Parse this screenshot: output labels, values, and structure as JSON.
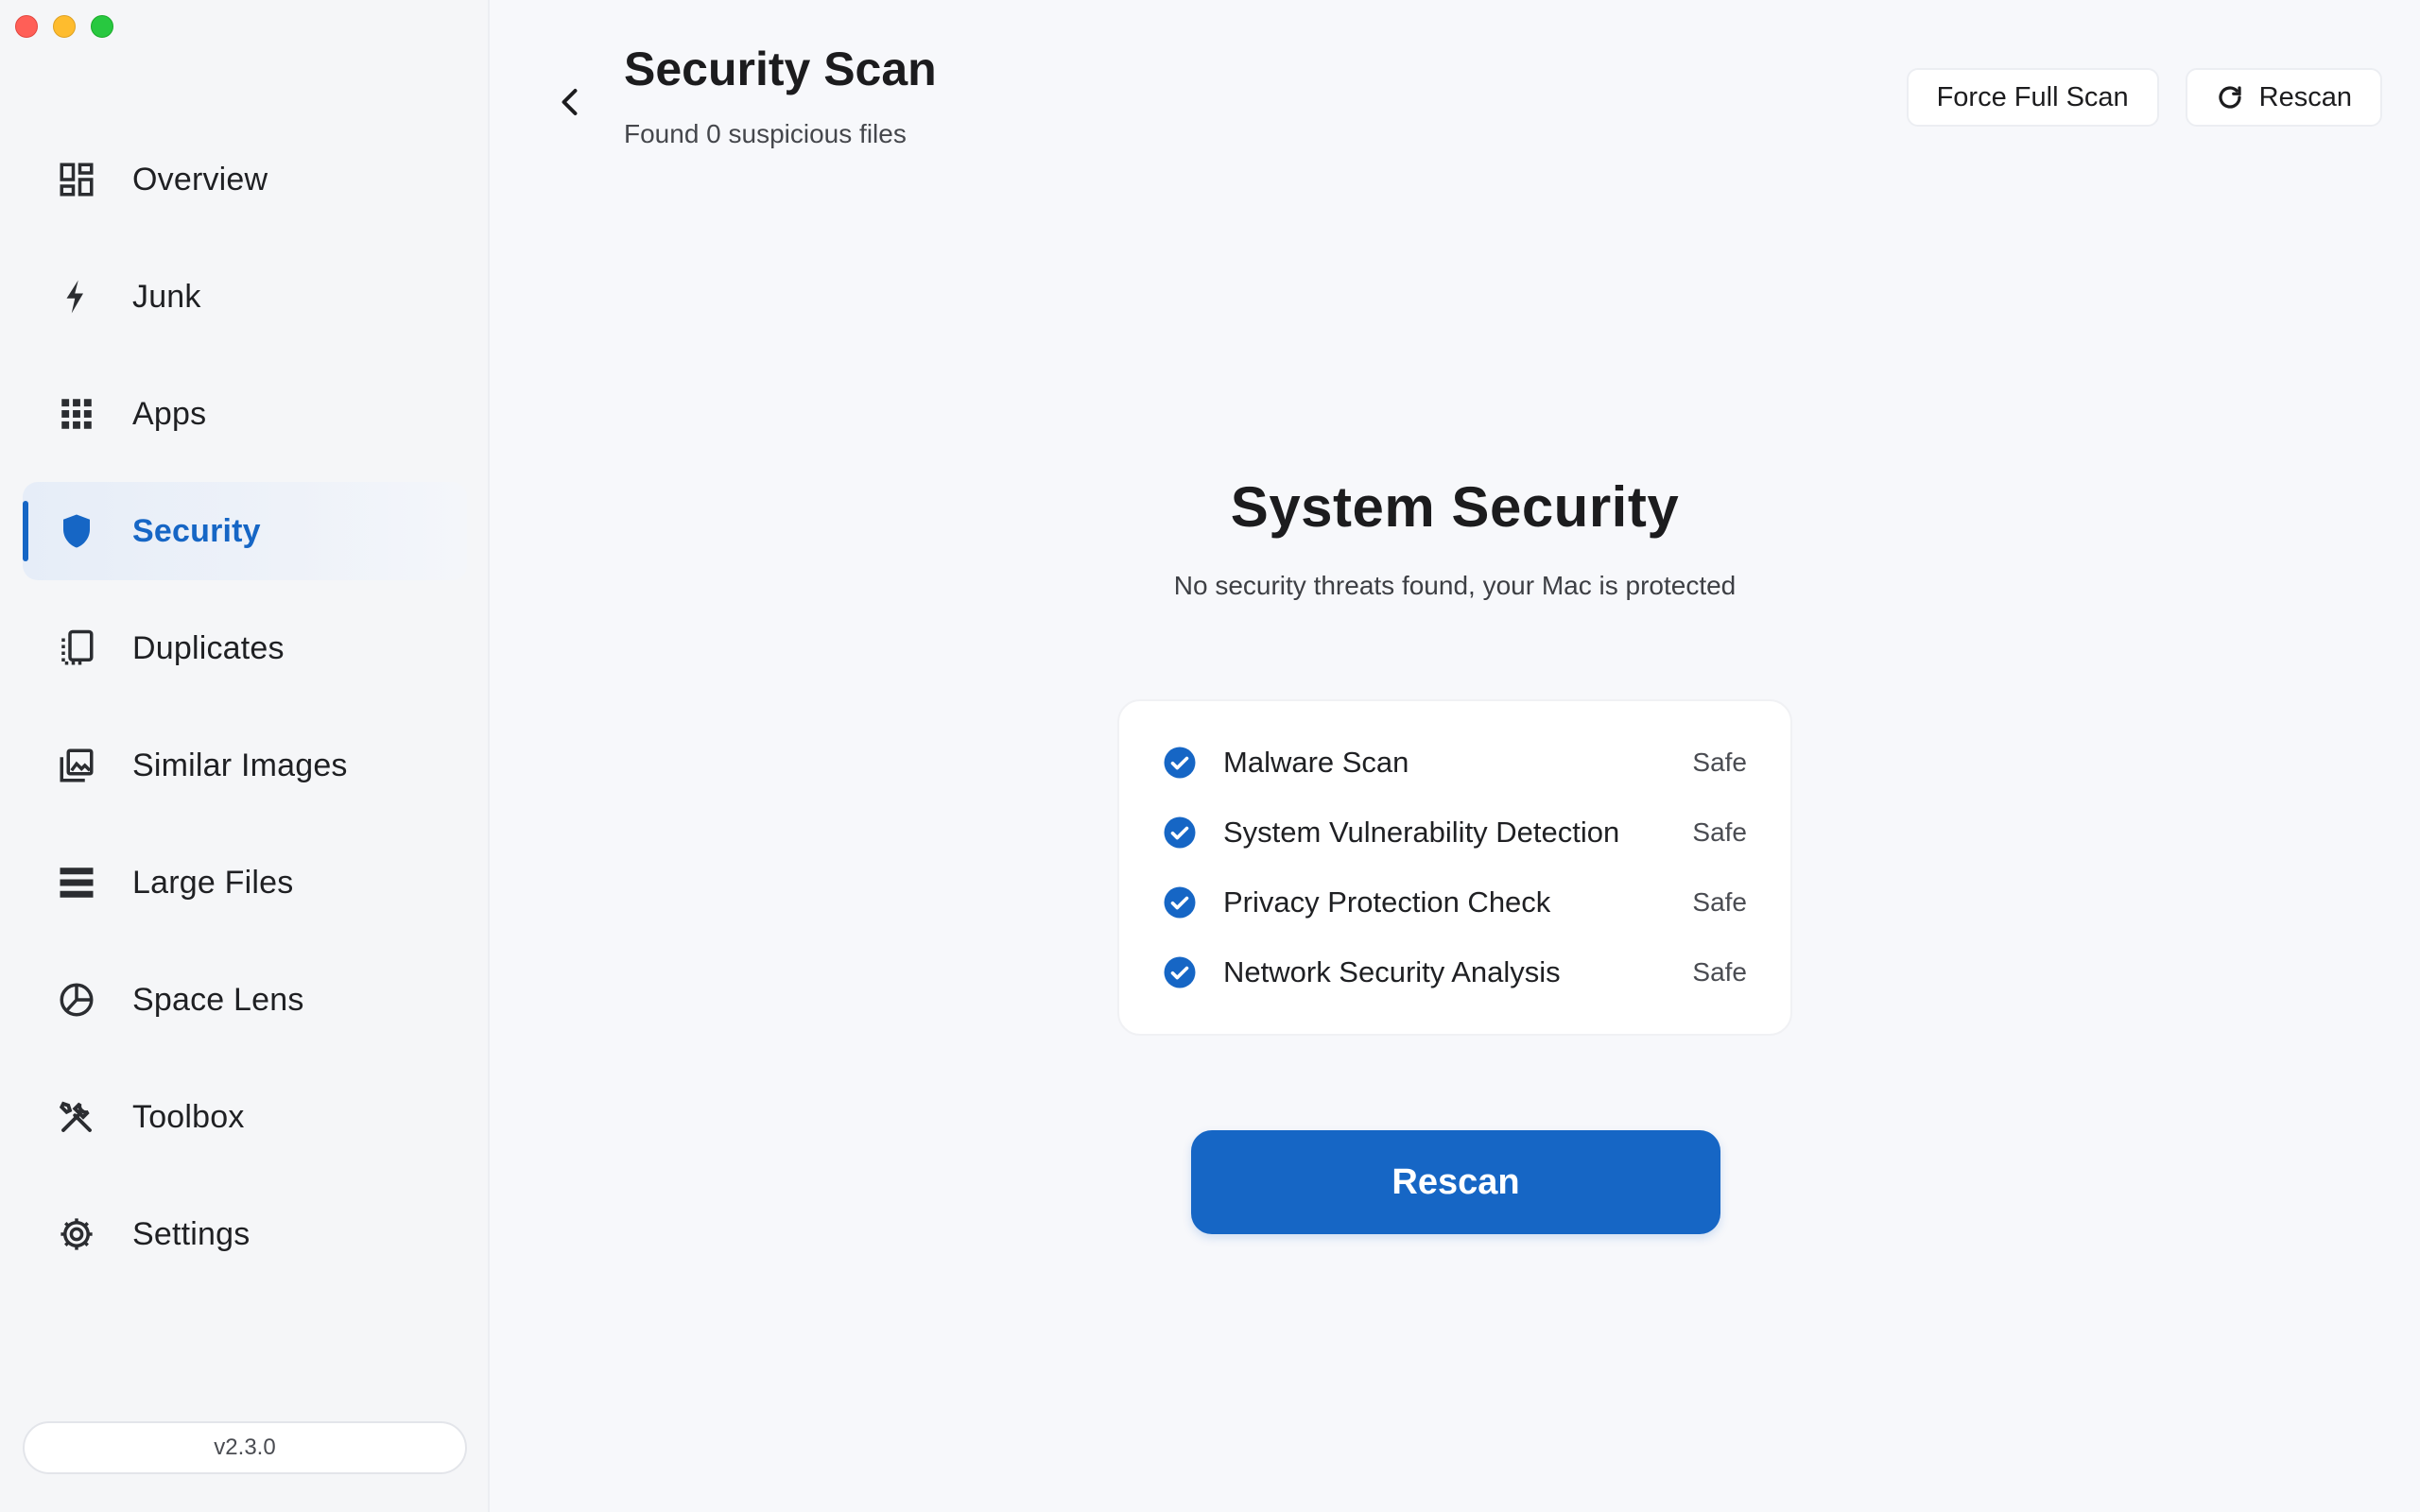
{
  "window": {
    "controls": [
      "close",
      "minimize",
      "zoom"
    ]
  },
  "sidebar": {
    "items": [
      {
        "label": "Overview",
        "icon": "overview-icon",
        "active": false
      },
      {
        "label": "Junk",
        "icon": "lightning-icon",
        "active": false
      },
      {
        "label": "Apps",
        "icon": "apps-grid-icon",
        "active": false
      },
      {
        "label": "Security",
        "icon": "shield-icon",
        "active": true
      },
      {
        "label": "Duplicates",
        "icon": "duplicates-icon",
        "active": false
      },
      {
        "label": "Similar Images",
        "icon": "images-icon",
        "active": false
      },
      {
        "label": "Large Files",
        "icon": "large-files-icon",
        "active": false
      },
      {
        "label": "Space Lens",
        "icon": "pie-chart-icon",
        "active": false
      },
      {
        "label": "Toolbox",
        "icon": "toolbox-icon",
        "active": false
      },
      {
        "label": "Settings",
        "icon": "gear-icon",
        "active": false
      }
    ],
    "version": "v2.3.0"
  },
  "header": {
    "title": "Security Scan",
    "subtitle": "Found 0 suspicious files",
    "force_full_scan_label": "Force Full Scan",
    "rescan_label": "Rescan"
  },
  "main": {
    "title": "System Security",
    "subtitle": "No security threats found, your Mac is protected",
    "checks": [
      {
        "label": "Malware Scan",
        "status": "Safe"
      },
      {
        "label": "System Vulnerability Detection",
        "status": "Safe"
      },
      {
        "label": "Privacy Protection Check",
        "status": "Safe"
      },
      {
        "label": "Network Security Analysis",
        "status": "Safe"
      }
    ],
    "rescan_button_label": "Rescan"
  },
  "colors": {
    "accent": "#1666c5",
    "sidebar_bg": "#f5f6f8",
    "main_bg": "#f7f8fb"
  }
}
